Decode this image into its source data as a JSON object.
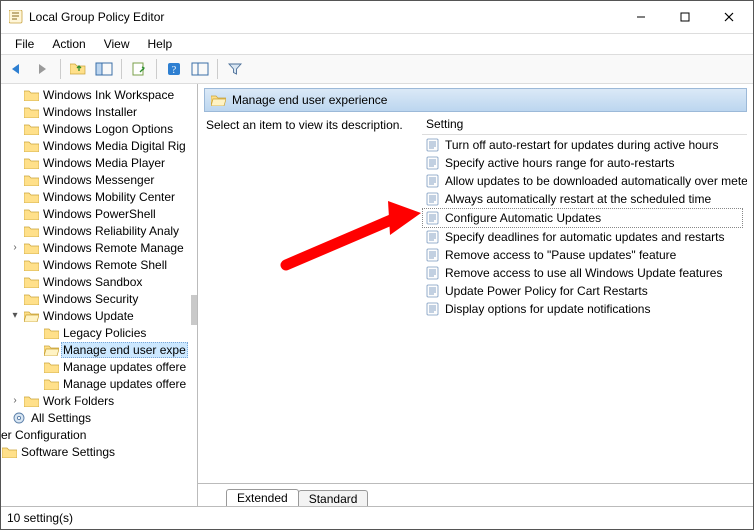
{
  "window": {
    "title": "Local Group Policy Editor"
  },
  "menu": {
    "file": "File",
    "action": "Action",
    "view": "View",
    "help": "Help"
  },
  "tree": {
    "items": [
      "Windows Ink Workspace",
      "Windows Installer",
      "Windows Logon Options",
      "Windows Media Digital Rig",
      "Windows Media Player",
      "Windows Messenger",
      "Windows Mobility Center",
      "Windows PowerShell",
      "Windows Reliability Analy",
      "Windows Remote Manage",
      "Windows Remote Shell",
      "Windows Sandbox",
      "Windows Security",
      "Windows Update"
    ],
    "update_children": [
      "Legacy Policies",
      "Manage end user expe",
      "Manage updates offere",
      "Manage updates offere"
    ],
    "work_folders": "Work Folders",
    "all_settings": "All Settings",
    "er_config": "er Configuration",
    "sw_settings": "Software Settings"
  },
  "header": {
    "label": "Manage end user experience"
  },
  "description": {
    "prompt": "Select an item to view its description."
  },
  "list": {
    "column": "Setting",
    "rows": [
      "Turn off auto-restart for updates during active hours",
      "Specify active hours range for auto-restarts",
      "Allow updates to be downloaded automatically over metere",
      "Always automatically restart at the scheduled time",
      "Configure Automatic Updates",
      "Specify deadlines for automatic updates and restarts",
      "Remove access to \"Pause updates\" feature",
      "Remove access to use all Windows Update features",
      "Update Power Policy for Cart Restarts",
      "Display options for update notifications"
    ]
  },
  "tabs": {
    "extended": "Extended",
    "standard": "Standard"
  },
  "status": {
    "text": "10 setting(s)"
  }
}
